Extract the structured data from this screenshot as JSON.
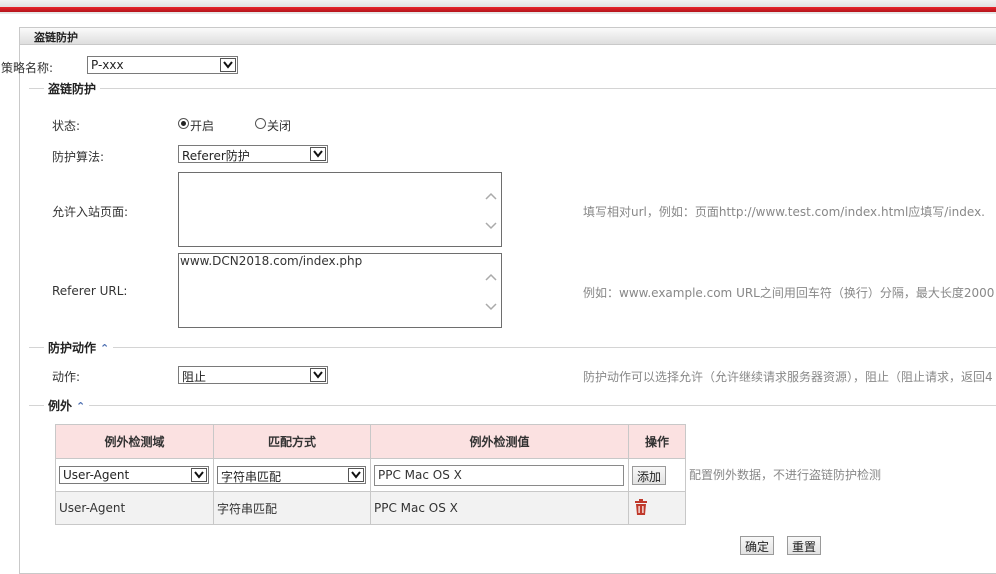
{
  "panel": {
    "title": "盗链防护"
  },
  "policy": {
    "label": "策略名称:",
    "value": "P-xxx"
  },
  "section_main": {
    "legend": "盗链防护"
  },
  "status": {
    "label": "状态:",
    "on_label": "开启",
    "off_label": "关闭",
    "selected": "开启"
  },
  "algorithm": {
    "label": "防护算法:",
    "value": "Referer防护"
  },
  "allowed_page": {
    "label": "允许入站页面:",
    "value": "",
    "hint": "填写相对url，例如：页面http://www.test.com/index.html应填写/index."
  },
  "referer_url": {
    "label": "Referer URL:",
    "value": "www.DCN2018.com/index.php",
    "hint": "例如：www.example.com URL之间用回车符（换行）分隔，最大长度2000"
  },
  "section_action": {
    "legend": "防护动作"
  },
  "action": {
    "label": "动作:",
    "value": "阻止",
    "hint": "防护动作可以选择允许（允许继续请求服务器资源），阻止（阻止请求，返回4"
  },
  "section_exception": {
    "legend": "例外"
  },
  "exception_table": {
    "headers": [
      "例外检测域",
      "匹配方式",
      "例外检测值",
      "操作"
    ],
    "input_row": {
      "field": "User-Agent",
      "match": "字符串匹配",
      "value": "PPC Mac OS X",
      "add_label": "添加"
    },
    "rows": [
      {
        "field": "User-Agent",
        "match": "字符串匹配",
        "value": "PPC Mac OS X"
      }
    ],
    "hint": "配置例外数据，不进行盗链防护检测"
  },
  "buttons": {
    "confirm": "确定",
    "reset": "重置"
  },
  "colors": {
    "brand_red": "#d71920",
    "table_header": "#fbe1e1",
    "chevron": "#4a6db0",
    "delete": "#c0392b"
  }
}
